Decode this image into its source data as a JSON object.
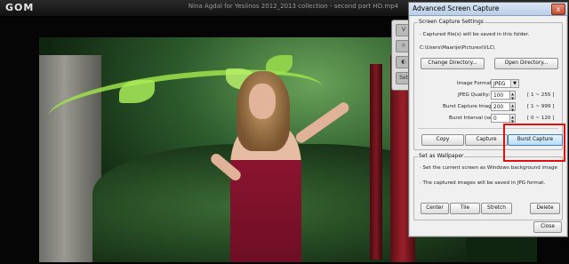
{
  "player": {
    "logo": "GOM",
    "title": "Nina Agdal for Yesiinos 2012_2013 collection - second part HD.mp4"
  },
  "ctrl_panel": {
    "tabs": [
      "V",
      "",
      "",
      "Set"
    ]
  },
  "dialog": {
    "title": "Advanced Screen Capture",
    "close": "x",
    "capture_settings": {
      "group_label": "Screen Capture Settings",
      "save_note": "· Captured file(s) will be saved in this folder.",
      "path": "C:\\Users\\Maarije\\Pictures\\VLC\\",
      "change_dir_label": "Change Directory...",
      "open_dir_label": "Open Directory...",
      "format_label": "Image Format:",
      "format_value": "JPEG",
      "quality_label": "JPEG Quality:",
      "quality_value": "100",
      "quality_range": "[ 1 ~ 255 ]",
      "burst_images_label": "Burst Capture Images:",
      "burst_images_value": "200",
      "burst_images_range": "[ 1 ~ 999 ]",
      "burst_interval_label": "Burst Interval (sec):",
      "burst_interval_value": "0",
      "burst_interval_range": "[ 0 ~ 120 ]",
      "copy_label": "Copy",
      "capture_label": "Capture",
      "burst_capture_label": "Burst Capture"
    },
    "wallpaper": {
      "group_label": "Set as Wallpaper",
      "note1": "· Set the current screen as Windows background image",
      "note2": "· The captured images will be saved in JPG format.",
      "center_label": "Center",
      "tile_label": "Tile",
      "stretch_label": "Stretch",
      "delete_label": "Delete"
    },
    "close_label": "Close"
  },
  "colors": {
    "highlight": "#e01010",
    "dialog_bg": "#f0f0f0"
  }
}
